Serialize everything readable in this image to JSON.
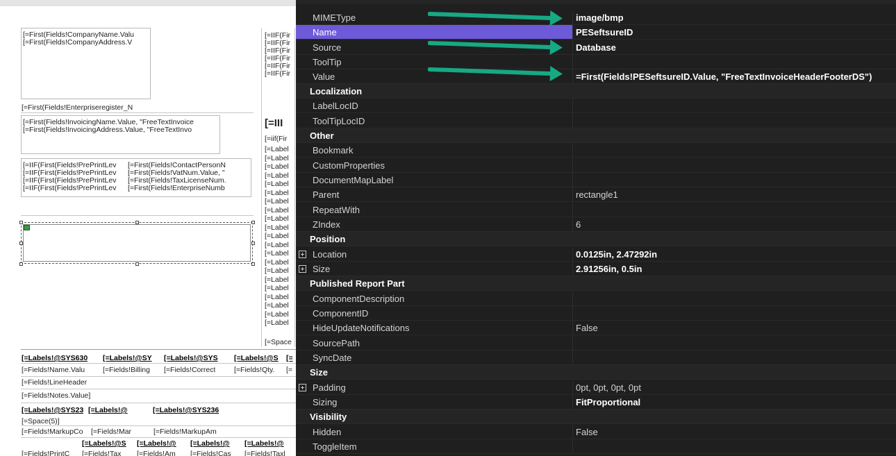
{
  "designer": {
    "company_block": [
      "[=First(Fields!CompanyName.Valu",
      "[=First(Fields!CompanyAddress.V"
    ],
    "enterprise_register": "[=First(Fields!Enterpriseregister_N",
    "invoicing_block": [
      "[=First(Fields!InvoicingName.Value, \"FreeTextInvoice",
      "[=First(Fields!InvoicingAddress.Value, \"FreeTextInvo"
    ],
    "iif_left": [
      "[=IIF(First(Fields!PrePrintLev",
      "[=IIF(First(Fields!PrePrintLev",
      "[=IIF(First(Fields!PrePrintLev",
      "[=IIF(First(Fields!PrePrintLev"
    ],
    "iif_right": [
      "[=First(Fields!ContactPersonN",
      "[=First(Fields!VatNum.Value, \"",
      "[=First(Fields!TaxLicenseNum.",
      "[=First(Fields!EnterpriseNumb"
    ],
    "right_col_top": [
      "[=IIF(Fir",
      "[=IIF(Fir",
      "[=IIF(Fir",
      "[=IIF(Fir",
      "[=IIF(Fir",
      "[=IIF(Fir"
    ],
    "right_big": "[=III",
    "right_iif_small": "[=iif(Fir",
    "right_labels": [
      "[=Label",
      "[=Label",
      "[=Label",
      "[=Label",
      "[=Label",
      "[=Label",
      "[=Label",
      "[=Label",
      "[=Label",
      "[=Label",
      "[=Label",
      "[=Label",
      "[=Label",
      "[=Label",
      "[=Label",
      "[=Label",
      "[=Label",
      "[=Label",
      "[=Label",
      "[=Label",
      "[=Label"
    ],
    "right_space": "[=Space",
    "table_header_1": [
      "[=Labels!@SYS630",
      "[=Labels!@SY",
      "[=Labels!@SYS",
      "[=Labels!@S",
      "[="
    ],
    "table_row_1": [
      "[=Fields!Name.Valu",
      "[=Fields!Billing",
      "[=Fields!Correct",
      "[=Fields!Qty.",
      "[="
    ],
    "line_header": "[=Fields!LineHeader",
    "notes_value": "[=Fields!Notes.Value]",
    "table_header_2": [
      "[=Labels!@SYS23",
      "[=Labels!@",
      "[=Labels!@SYS236"
    ],
    "space5": "[=Space(5)]",
    "markup_row": [
      "[=Fields!MarkupCo",
      "[=Fields!Mar",
      "[=Fields!MarkupAm"
    ],
    "table_header_3": [
      "[=Labels!@S",
      "[=Labels!@",
      "[=Labels!@",
      "[=Labels!@"
    ],
    "print_row": [
      "[=Fields!PrintC",
      "[=Fields!Tax",
      "[=Fields!Am",
      "[=Fields!Cas",
      "[=Fields!Taxl"
    ]
  },
  "properties": {
    "general": {
      "mimetype_name": "MIMEType",
      "mimetype_value": "image/bmp",
      "name_name": "Name",
      "name_value": "PESeftsureID",
      "source_name": "Source",
      "source_value": "Database",
      "tooltip_name": "ToolTip",
      "value_name": "Value",
      "value_value": "=First(Fields!PESeftsureID.Value, \"FreeTextInvoiceHeaderFooterDS\")"
    },
    "localization": {
      "label": "Localization",
      "labellocid": "LabelLocID",
      "tooltiplocid": "ToolTipLocID"
    },
    "other": {
      "label": "Other",
      "bookmark": "Bookmark",
      "customproperties": "CustomProperties",
      "documentmaplabel": "DocumentMapLabel",
      "parent_name": "Parent",
      "parent_value": "rectangle1",
      "repeatwith": "RepeatWith",
      "zindex_name": "ZIndex",
      "zindex_value": "6"
    },
    "position": {
      "label": "Position",
      "location_name": "Location",
      "location_value": "0.0125in, 2.47292in",
      "size_name": "Size",
      "size_value": "2.91256in, 0.5in"
    },
    "published": {
      "label": "Published Report Part",
      "componentdescription": "ComponentDescription",
      "componentid": "ComponentID",
      "hideupdate_name": "HideUpdateNotifications",
      "hideupdate_value": "False",
      "sourcepath": "SourcePath",
      "syncdate": "SyncDate"
    },
    "size": {
      "label": "Size",
      "padding_name": "Padding",
      "padding_value": "0pt, 0pt, 0pt, 0pt",
      "sizing_name": "Sizing",
      "sizing_value": "FitProportional"
    },
    "visibility": {
      "label": "Visibility",
      "hidden_name": "Hidden",
      "hidden_value": "False",
      "toggleitem": "ToggleItem"
    }
  },
  "colors": {
    "selected_row": "#6d5ad8",
    "arrow": "#16a984",
    "background": "#1f1f1f"
  }
}
